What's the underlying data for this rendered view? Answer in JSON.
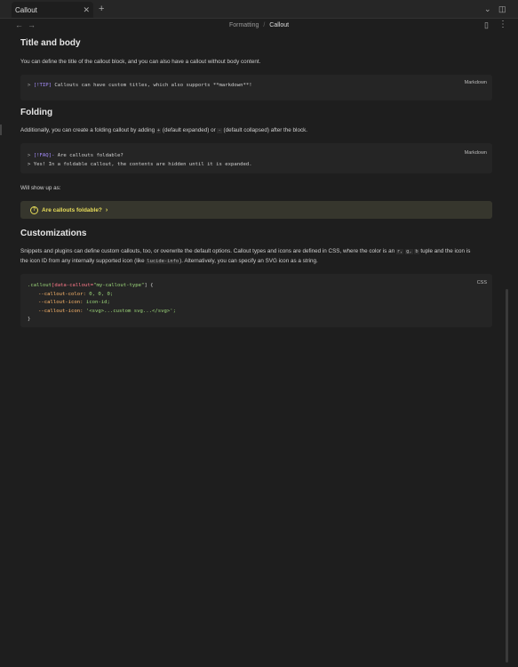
{
  "tab": {
    "title": "Callout",
    "close": "✕",
    "add": "+"
  },
  "window": {
    "chevron": "⌄",
    "sidebar_toggle": "◫"
  },
  "nav": {
    "back": "←",
    "forward": "→",
    "crumb_parent": "Formatting",
    "crumb_sep": "/",
    "crumb_current": "Callout",
    "reading_view": "▯"
  },
  "section1": {
    "heading": "Title and body",
    "text": "You can define the title of the callout block, and you can also have a callout without body content.",
    "code_lang": "Markdown",
    "code_gt": ">",
    "code_tag": "[!TIP]",
    "code_rest": " Callouts can have custom titles, which also supports **markdown**!"
  },
  "section2": {
    "heading": "Folding",
    "text_a": "Additionally, you can create a folding callout by adding",
    "plus": "+",
    "text_b": "(default expanded) or",
    "minus": "-",
    "text_c": "(default collapsed) after the block.",
    "code_lang": "Markdown",
    "line1_gt": ">",
    "line1_tag": "[!FAQ]-",
    "line1_rest": " Are callouts foldable?",
    "line2": "> Yes! In a foldable callout, the contents are hidden until it is expanded.",
    "showup": "Will show up as:",
    "callout_icon": "?",
    "callout_title": "Are callouts foldable?",
    "callout_chevron": "›"
  },
  "section3": {
    "heading": "Customizations",
    "text1_a": "Snippets and plugins can define custom callouts, too, or overwrite the default options. Callout types and icons are defined in CSS, where the color is an",
    "r": "r,",
    "g": "g,",
    "b": "b",
    "text1_b": "tuple and the icon is",
    "text2_a": "the icon ID from any internally supported icon (like",
    "lucide": "lucide-info",
    "text2_b": "). Alternatively, you can specify an SVG icon as a string.",
    "code_lang": "CSS",
    "css_sel": ".callout",
    "css_attr": "[data-callout=",
    "css_attrval": "\"my-callout-type\"",
    "css_attrend": "] {",
    "css_p1": "--callout-color:",
    "css_v1": " 0, 0, 0;",
    "css_p2": "--callout-icon:",
    "css_v2": " icon-id;",
    "css_p3": "--callout-icon:",
    "css_v3": " '<svg>...custom svg...</svg>';",
    "css_close": "}"
  }
}
